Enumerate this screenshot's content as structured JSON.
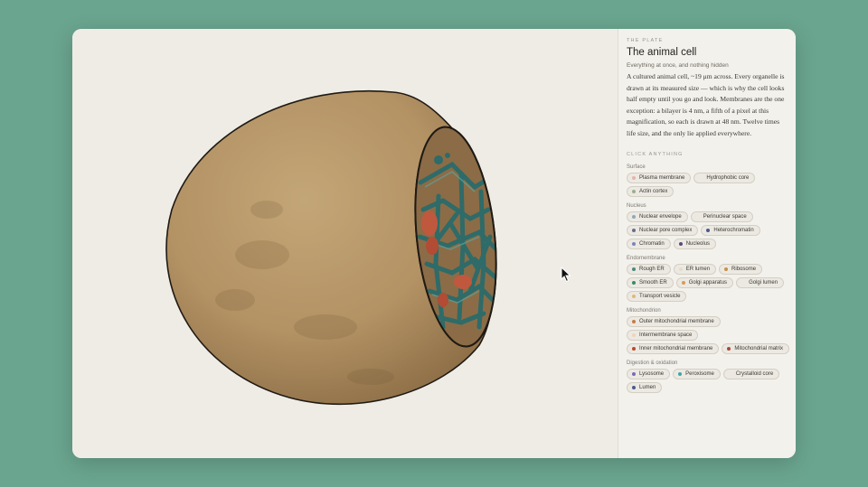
{
  "panel": {
    "eyebrow": "THE PLATE",
    "title": "The animal cell",
    "subtitle": "Everything at once, and nothing hidden",
    "body": "A cultured animal cell, ~19 μm across. Every organelle is drawn at its measured size — which is why the cell looks half empty until you go and look. Membranes are the one exception: a bilayer is 4 nm, a fifth of a pixel at this magnification, so each is drawn at 48 nm. Twelve times life size, and the only lie applied everywhere.",
    "click_label": "CLICK ANYTHING",
    "groups": [
      {
        "label": "Surface",
        "items": [
          {
            "name": "Plasma membrane",
            "color": "#e8b4a8"
          },
          {
            "name": "Hydrophobic core",
            "color": "#ece9e2"
          },
          {
            "name": "Actin cortex",
            "color": "#9bb08a"
          }
        ]
      },
      {
        "label": "Nucleus",
        "items": [
          {
            "name": "Nuclear envelope",
            "color": "#8fa9b8"
          },
          {
            "name": "Perinuclear space",
            "color": "#ece9e2"
          },
          {
            "name": "Nuclear pore complex",
            "color": "#6a6e8a"
          },
          {
            "name": "Heterochromatin",
            "color": "#4a5a8a"
          },
          {
            "name": "Chromatin",
            "color": "#7a86b8"
          },
          {
            "name": "Nucleolus",
            "color": "#5a4a7a"
          }
        ]
      },
      {
        "label": "Endomembrane",
        "items": [
          {
            "name": "Rough ER",
            "color": "#4a8a7a"
          },
          {
            "name": "ER lumen",
            "color": "#e6dccc"
          },
          {
            "name": "Ribosome",
            "color": "#c8904a"
          },
          {
            "name": "Smooth ER",
            "color": "#3a8a6a"
          },
          {
            "name": "Golgi apparatus",
            "color": "#d89a5a"
          },
          {
            "name": "Golgi lumen",
            "color": "#ece9e2"
          },
          {
            "name": "Transport vesicle",
            "color": "#e0b87a"
          }
        ]
      },
      {
        "label": "Mitochondrion",
        "items": [
          {
            "name": "Outer mitochondrial membrane",
            "color": "#c87a4a"
          },
          {
            "name": "Intermembrane space",
            "color": "#f0d4b8"
          },
          {
            "name": "Inner mitochondrial membrane",
            "color": "#b84a2a"
          },
          {
            "name": "Mitochondrial matrix",
            "color": "#a8483a"
          }
        ]
      },
      {
        "label": "Digestion & oxidation",
        "items": [
          {
            "name": "Lysosome",
            "color": "#7a6ab8"
          },
          {
            "name": "Peroxisome",
            "color": "#3aa8a8"
          },
          {
            "name": "Crystalloid core",
            "color": "#ece9e2"
          },
          {
            "name": "Lumen",
            "color": "#4a5a8a"
          }
        ]
      }
    ]
  },
  "canvas": {
    "subject": "cutaway-cell",
    "colors": {
      "cytoplasm": "#b99b6c",
      "interior": "#8a6a44",
      "organelles": "#3f7e78",
      "mito": "#c0583e",
      "outline": "#1f1a14"
    }
  }
}
